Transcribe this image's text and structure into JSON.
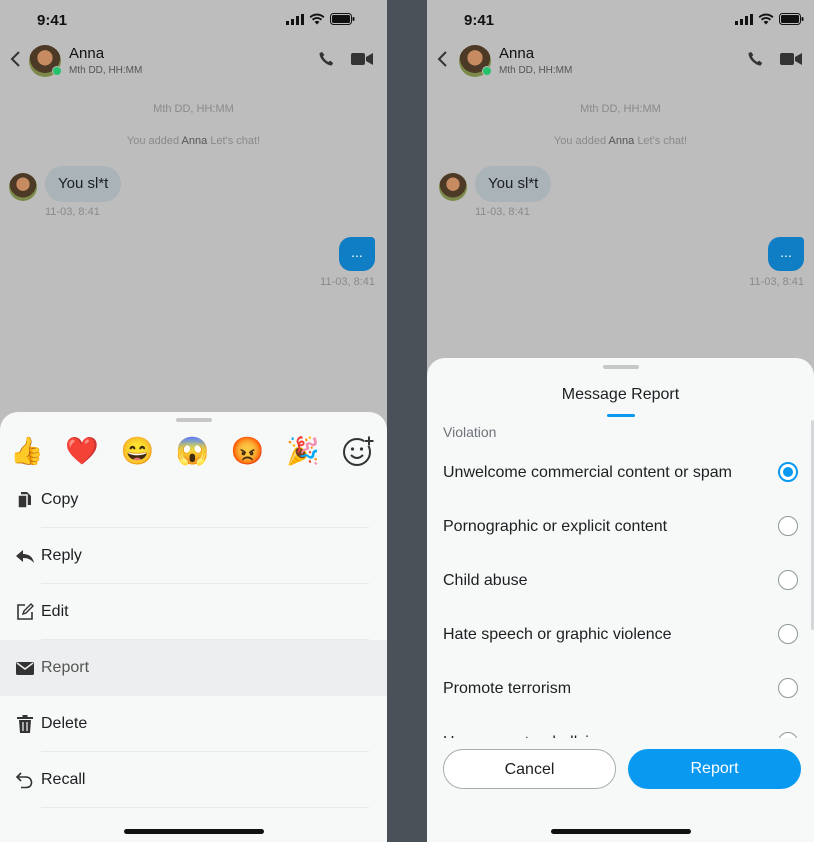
{
  "status_bar": {
    "time": "9:41"
  },
  "contact": {
    "name": "Anna",
    "subtitle": "Mth DD, HH:MM"
  },
  "chat": {
    "date_divider": "Mth DD, HH:MM",
    "system_prefix": "You added",
    "system_name": "Anna",
    "system_suffix": "Let's chat!",
    "incoming_text": "You sl*t",
    "incoming_time": "11-03, 8:41",
    "outgoing_text": "...",
    "outgoing_time": "11-03, 8:41"
  },
  "reactions": [
    "👍",
    "❤️",
    "😄",
    "😱",
    "😡",
    "🎉"
  ],
  "menu": [
    {
      "label": "Copy",
      "icon": "copy-icon"
    },
    {
      "label": "Reply",
      "icon": "reply-icon"
    },
    {
      "label": "Edit",
      "icon": "edit-icon"
    },
    {
      "label": "Report",
      "icon": "envelope-icon"
    },
    {
      "label": "Delete",
      "icon": "trash-icon"
    },
    {
      "label": "Recall",
      "icon": "recall-icon"
    }
  ],
  "report_sheet": {
    "title": "Message Report",
    "section_label": "Violation",
    "options": [
      {
        "label": "Unwelcome commercial content or spam",
        "selected": true
      },
      {
        "label": "Pornographic or explicit content",
        "selected": false
      },
      {
        "label": "Child abuse",
        "selected": false
      },
      {
        "label": "Hate speech or graphic violence",
        "selected": false
      },
      {
        "label": "Promote terrorism",
        "selected": false
      },
      {
        "label": "Harassment or bullying",
        "selected": false
      }
    ],
    "cancel_label": "Cancel",
    "report_label": "Report"
  },
  "colors": {
    "accent": "#0a99f0",
    "outgoing_bubble": "#0f7ec4",
    "online": "#24c26b"
  }
}
